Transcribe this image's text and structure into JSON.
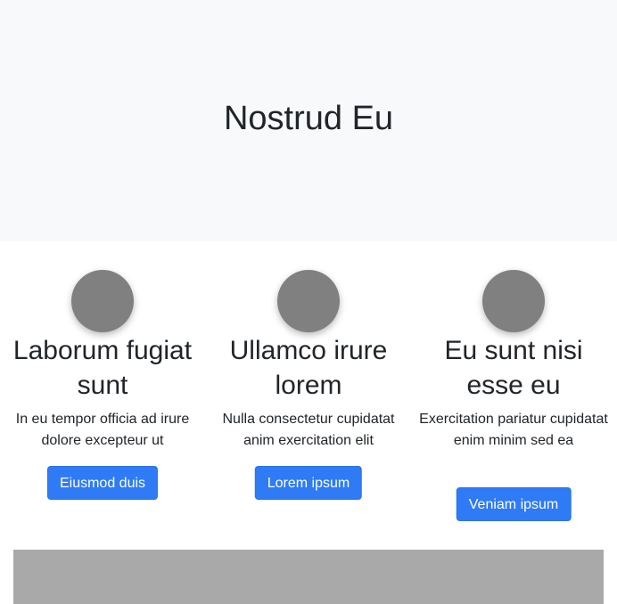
{
  "hero": {
    "title": "Nostrud Eu"
  },
  "features": [
    {
      "title": "Laborum fugiat sunt",
      "text": "In eu tempor officia ad irure dolore excepteur ut",
      "button": "Eiusmod duis"
    },
    {
      "title": "Ullamco irure lorem",
      "text": "Nulla consectetur cupidatat anim exercitation elit",
      "button": "Lorem ipsum"
    },
    {
      "title": "Eu sunt nisi esse eu",
      "text": "Exercitation pariatur cupidatat enim minim sed ea",
      "button": "Veniam ipsum"
    }
  ],
  "colors": {
    "hero_bg": "#f8f9fa",
    "circle": "#808080",
    "button": "#2f7bf5",
    "panel_bg": "#a9a9a9"
  }
}
